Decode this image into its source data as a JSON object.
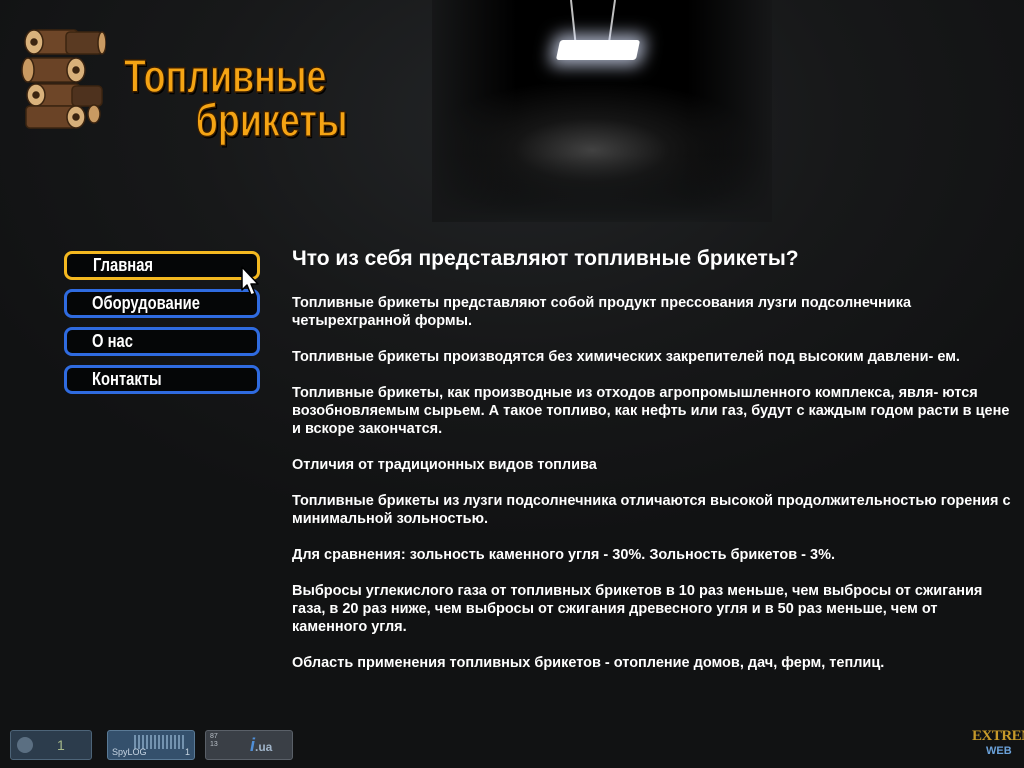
{
  "logo": {
    "title_line1": "Топливные",
    "title_line2": "брикеты"
  },
  "nav": {
    "items": [
      {
        "label": "Главная",
        "active": true
      },
      {
        "label": "Оборудование",
        "active": false
      },
      {
        "label": "О нас",
        "active": false
      },
      {
        "label": "Контакты",
        "active": false
      }
    ]
  },
  "content": {
    "heading": "Что из себя представляют топливные брикеты?",
    "paragraphs": [
      "Топливные брикеты представляют собой продукт прессования лузги подсолнечника четырехгранной формы.",
      "Топливные брикеты производятся без химических закрепителей под высоким давлени- ем.",
      "Топливные брикеты, как производные из отходов агропромышленного комплекса, явля- ются возобновляемым сырьем. А такое топливо, как нефть или газ, будут с каждым годом расти в цене и вскоре закончатся.",
      "Отличия от традиционных видов топлива",
      "Топливные брикеты из лузги подсолнечника отличаются высокой продолжительностью горения с минимальной зольностью.",
      "Для сравнения: зольность каменного угля - 30%. Зольность брикетов - 3%.",
      "Выбросы углекислого газа от топливных брикетов в 10 раз меньше, чем выбросы от сжигания газа, в 20 раз ниже, чем выбросы от сжигания древесного угля и в 50 раз меньше, чем от каменного угля.",
      "Область применения топливных брикетов - отопление домов, дач, ферм, теплиц."
    ]
  },
  "footer": {
    "counter1_value": "1",
    "counter2_label": "SpyLOG",
    "counter2_value": "1",
    "counter3_line1": "87",
    "counter3_line2": "13",
    "counter3_brand": "i",
    "counter3_tld": ".ua",
    "brand_line1": "EXTREME",
    "brand_line2": "WEB"
  },
  "colors": {
    "accent_orange": "#f5a414",
    "nav_border": "#2f6be0",
    "nav_active_border": "#f4b820",
    "background": "#151617"
  },
  "icons": {
    "pointer": "mouse-pointer-icon",
    "counter1": "globe-icon"
  }
}
